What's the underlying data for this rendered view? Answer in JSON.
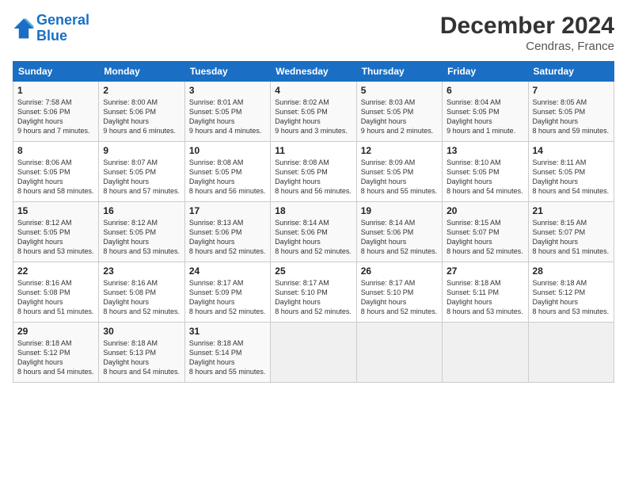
{
  "header": {
    "logo_line1": "General",
    "logo_line2": "Blue",
    "month": "December 2024",
    "location": "Cendras, France"
  },
  "weekdays": [
    "Sunday",
    "Monday",
    "Tuesday",
    "Wednesday",
    "Thursday",
    "Friday",
    "Saturday"
  ],
  "weeks": [
    [
      {
        "day": "1",
        "sunrise": "7:58 AM",
        "sunset": "5:06 PM",
        "daylight": "9 hours and 7 minutes."
      },
      {
        "day": "2",
        "sunrise": "8:00 AM",
        "sunset": "5:06 PM",
        "daylight": "9 hours and 6 minutes."
      },
      {
        "day": "3",
        "sunrise": "8:01 AM",
        "sunset": "5:05 PM",
        "daylight": "9 hours and 4 minutes."
      },
      {
        "day": "4",
        "sunrise": "8:02 AM",
        "sunset": "5:05 PM",
        "daylight": "9 hours and 3 minutes."
      },
      {
        "day": "5",
        "sunrise": "8:03 AM",
        "sunset": "5:05 PM",
        "daylight": "9 hours and 2 minutes."
      },
      {
        "day": "6",
        "sunrise": "8:04 AM",
        "sunset": "5:05 PM",
        "daylight": "9 hours and 1 minute."
      },
      {
        "day": "7",
        "sunrise": "8:05 AM",
        "sunset": "5:05 PM",
        "daylight": "8 hours and 59 minutes."
      }
    ],
    [
      {
        "day": "8",
        "sunrise": "8:06 AM",
        "sunset": "5:05 PM",
        "daylight": "8 hours and 58 minutes."
      },
      {
        "day": "9",
        "sunrise": "8:07 AM",
        "sunset": "5:05 PM",
        "daylight": "8 hours and 57 minutes."
      },
      {
        "day": "10",
        "sunrise": "8:08 AM",
        "sunset": "5:05 PM",
        "daylight": "8 hours and 56 minutes."
      },
      {
        "day": "11",
        "sunrise": "8:08 AM",
        "sunset": "5:05 PM",
        "daylight": "8 hours and 56 minutes."
      },
      {
        "day": "12",
        "sunrise": "8:09 AM",
        "sunset": "5:05 PM",
        "daylight": "8 hours and 55 minutes."
      },
      {
        "day": "13",
        "sunrise": "8:10 AM",
        "sunset": "5:05 PM",
        "daylight": "8 hours and 54 minutes."
      },
      {
        "day": "14",
        "sunrise": "8:11 AM",
        "sunset": "5:05 PM",
        "daylight": "8 hours and 54 minutes."
      }
    ],
    [
      {
        "day": "15",
        "sunrise": "8:12 AM",
        "sunset": "5:05 PM",
        "daylight": "8 hours and 53 minutes."
      },
      {
        "day": "16",
        "sunrise": "8:12 AM",
        "sunset": "5:05 PM",
        "daylight": "8 hours and 53 minutes."
      },
      {
        "day": "17",
        "sunrise": "8:13 AM",
        "sunset": "5:06 PM",
        "daylight": "8 hours and 52 minutes."
      },
      {
        "day": "18",
        "sunrise": "8:14 AM",
        "sunset": "5:06 PM",
        "daylight": "8 hours and 52 minutes."
      },
      {
        "day": "19",
        "sunrise": "8:14 AM",
        "sunset": "5:06 PM",
        "daylight": "8 hours and 52 minutes."
      },
      {
        "day": "20",
        "sunrise": "8:15 AM",
        "sunset": "5:07 PM",
        "daylight": "8 hours and 52 minutes."
      },
      {
        "day": "21",
        "sunrise": "8:15 AM",
        "sunset": "5:07 PM",
        "daylight": "8 hours and 51 minutes."
      }
    ],
    [
      {
        "day": "22",
        "sunrise": "8:16 AM",
        "sunset": "5:08 PM",
        "daylight": "8 hours and 51 minutes."
      },
      {
        "day": "23",
        "sunrise": "8:16 AM",
        "sunset": "5:08 PM",
        "daylight": "8 hours and 52 minutes."
      },
      {
        "day": "24",
        "sunrise": "8:17 AM",
        "sunset": "5:09 PM",
        "daylight": "8 hours and 52 minutes."
      },
      {
        "day": "25",
        "sunrise": "8:17 AM",
        "sunset": "5:10 PM",
        "daylight": "8 hours and 52 minutes."
      },
      {
        "day": "26",
        "sunrise": "8:17 AM",
        "sunset": "5:10 PM",
        "daylight": "8 hours and 52 minutes."
      },
      {
        "day": "27",
        "sunrise": "8:18 AM",
        "sunset": "5:11 PM",
        "daylight": "8 hours and 53 minutes."
      },
      {
        "day": "28",
        "sunrise": "8:18 AM",
        "sunset": "5:12 PM",
        "daylight": "8 hours and 53 minutes."
      }
    ],
    [
      {
        "day": "29",
        "sunrise": "8:18 AM",
        "sunset": "5:12 PM",
        "daylight": "8 hours and 54 minutes."
      },
      {
        "day": "30",
        "sunrise": "8:18 AM",
        "sunset": "5:13 PM",
        "daylight": "8 hours and 54 minutes."
      },
      {
        "day": "31",
        "sunrise": "8:18 AM",
        "sunset": "5:14 PM",
        "daylight": "8 hours and 55 minutes."
      },
      null,
      null,
      null,
      null
    ]
  ]
}
